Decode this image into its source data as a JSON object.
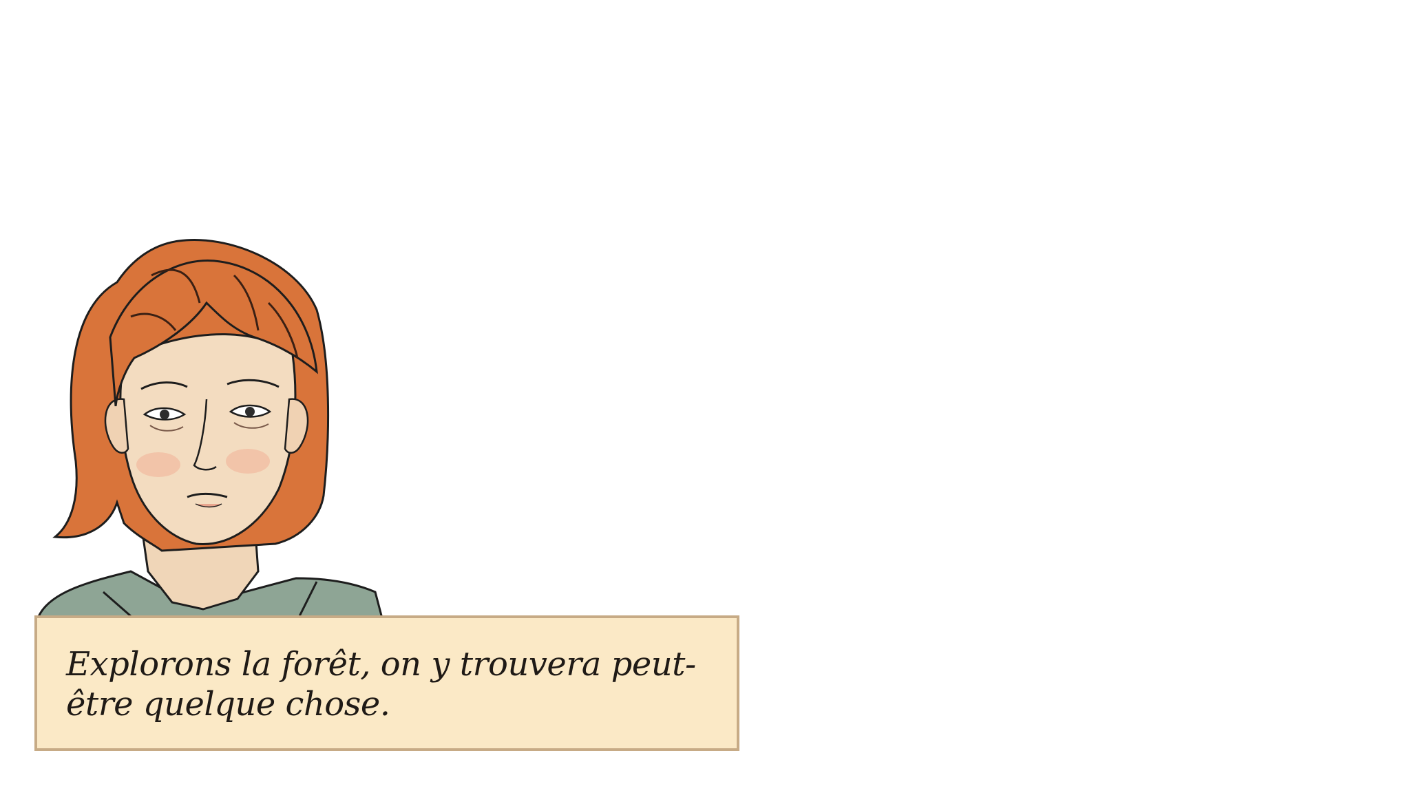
{
  "dialog": {
    "text": "Explorons la forêt, on y trouvera peut-être quelque chose."
  },
  "character": {
    "portrait_icon": "character-portrait",
    "hair_color": "#d9743a",
    "skin_color": "#f3dcc0",
    "shirt_color": "#8ea595"
  },
  "colors": {
    "background": "#ffffff",
    "dialog_fill": "#fbe9c6",
    "dialog_border": "#c7ab86",
    "text": "#1f1a16"
  }
}
